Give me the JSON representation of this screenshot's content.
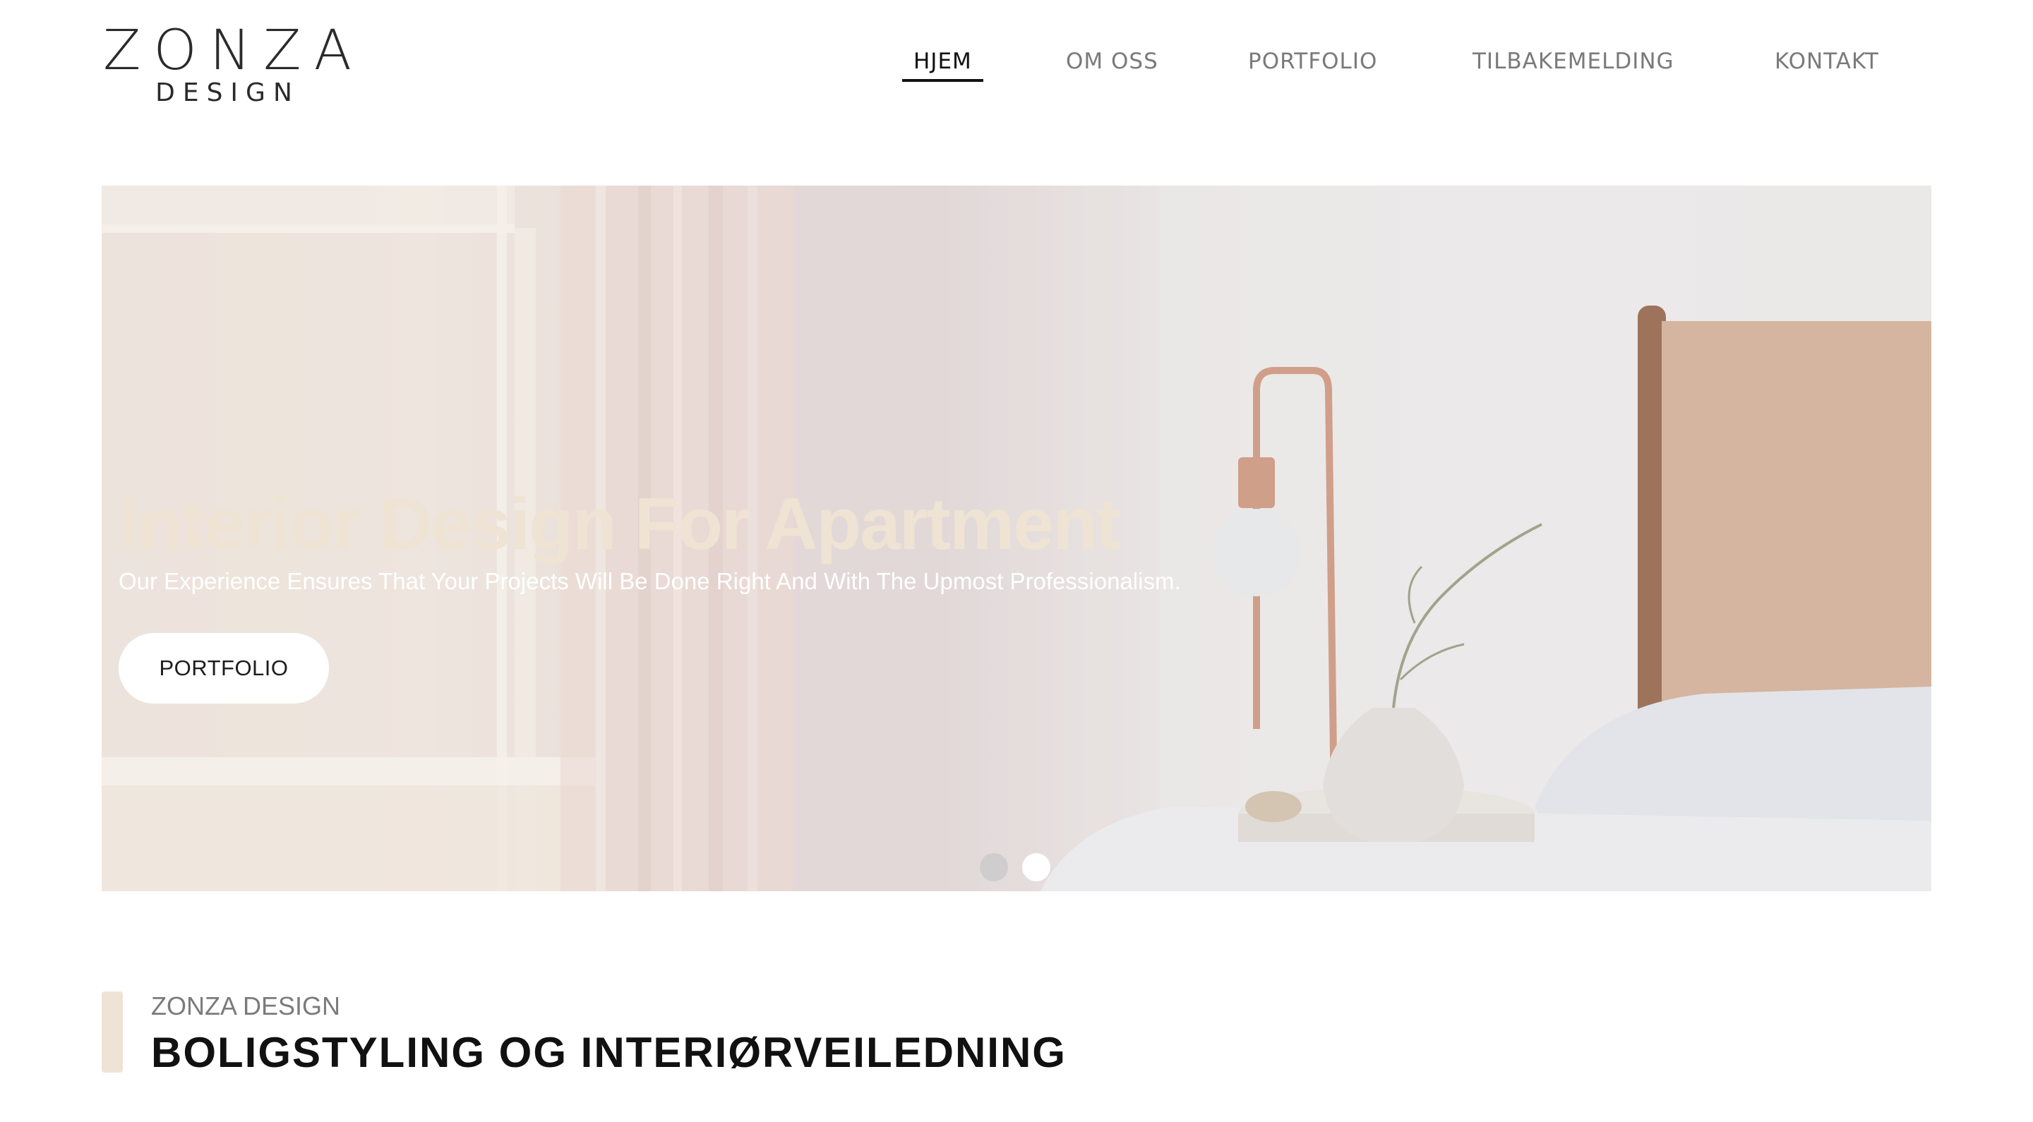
{
  "brand": {
    "logo_main": "ZONZA",
    "logo_sub": "DESIGN"
  },
  "nav": {
    "items": [
      {
        "label": "HJEM",
        "active": true
      },
      {
        "label": "OM OSS",
        "active": false
      },
      {
        "label": "PORTFOLIO",
        "active": false
      },
      {
        "label": "TILBAKEMELDING",
        "active": false
      },
      {
        "label": "KONTAKT",
        "active": false
      }
    ]
  },
  "hero": {
    "title": "Interior Design For Apartment",
    "subtitle": "Our Experience Ensures That Your Projects Will Be Done Right And With The Upmost Professionalism.",
    "button_label": "PORTFOLIO",
    "slides_total": 2,
    "active_slide": 2
  },
  "section": {
    "kicker": "ZONZA DESIGN",
    "heading": "BOLIGSTYLING OG INTERIØRVEILEDNING"
  },
  "colors": {
    "accent": "#efe3d6",
    "hero_title": "#efe3d4",
    "nav_active": "#111111",
    "nav_inactive": "#7a7a7a"
  }
}
